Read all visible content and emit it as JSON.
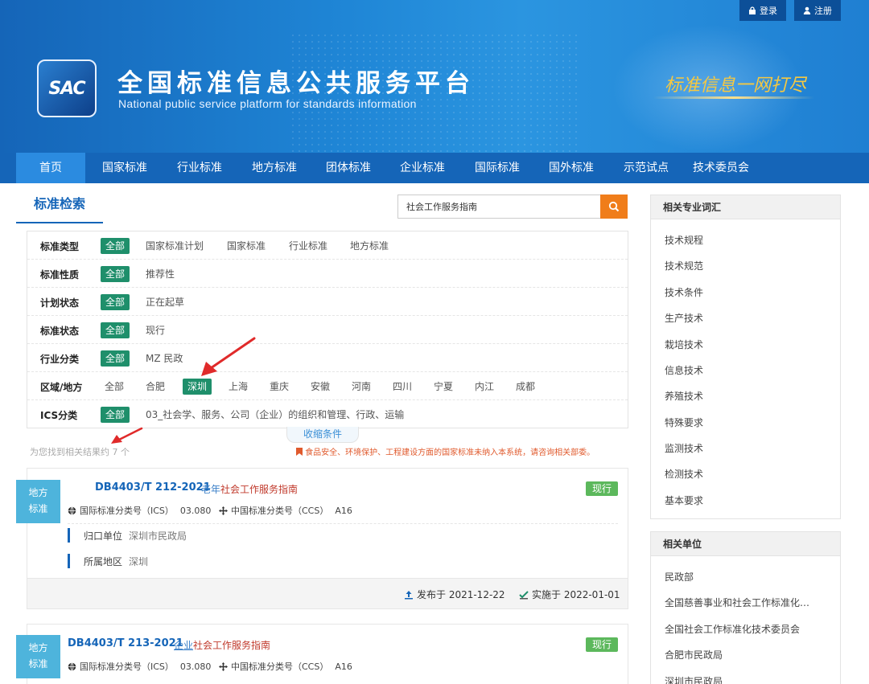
{
  "header": {
    "logo_text": "SAC",
    "title": "全国标准信息公共服务平台",
    "subtitle": "National public service platform  for standards information",
    "slogan": "标准信息一网打尽",
    "login_label": "登录",
    "register_label": "注册"
  },
  "nav": [
    "首页",
    "国家标准",
    "行业标准",
    "地方标准",
    "团体标准",
    "企业标准",
    "国际标准",
    "国外标准",
    "示范试点",
    "技术委员会"
  ],
  "search": {
    "tab_label": "标准检索",
    "query": "社会工作服务指南"
  },
  "filters": [
    {
      "label": "标准类型",
      "options": [
        "全部",
        "国家标准计划",
        "国家标准",
        "行业标准",
        "地方标准"
      ],
      "selected": 0
    },
    {
      "label": "标准性质",
      "options": [
        "全部",
        "推荐性"
      ],
      "selected": 0
    },
    {
      "label": "计划状态",
      "options": [
        "全部",
        "正在起草"
      ],
      "selected": 0
    },
    {
      "label": "标准状态",
      "options": [
        "全部",
        "现行"
      ],
      "selected": 0
    },
    {
      "label": "行业分类",
      "options": [
        "全部",
        "MZ 民政"
      ],
      "selected": 0
    },
    {
      "label": "区域/地方",
      "options": [
        "全部",
        "合肥",
        "深圳",
        "上海",
        "重庆",
        "安徽",
        "河南",
        "四川",
        "宁夏",
        "内江",
        "成都"
      ],
      "selected": 2
    },
    {
      "label": "ICS分类",
      "options": [
        "全部",
        "03_社会学、服务、公司（企业）的组织和管理、行政、运输"
      ],
      "selected": 0
    }
  ],
  "collapse_label": "收缩条件",
  "result_count_text": "为您找到相关结果约 7 个",
  "notice_text": "食品安全、环境保护、工程建设方面的国家标准未纳入本系统，请咨询相关部委。",
  "results": [
    {
      "tag_line1": "地方",
      "tag_line2": "标准",
      "number": "DB4403/T 212-2021",
      "title_prefix": "老年",
      "title_main": "社会工作服务指南",
      "status": "现行",
      "ics_label": "国际标准分类号（ICS）",
      "ics_value": "03.080",
      "ccs_label": "中国标准分类号（CCS）",
      "ccs_value": "A16",
      "dept_label": "归口单位",
      "dept_value": "深圳市民政局",
      "region_label": "所属地区",
      "region_value": "深圳",
      "publish": "发布于 2021-12-22",
      "implement": "实施于 2022-01-01"
    },
    {
      "tag_line1": "地方",
      "tag_line2": "标准",
      "number": "DB4403/T 213-2021",
      "title_prefix": "企业",
      "title_main": "社会工作服务指南",
      "status": "现行",
      "ics_label": "国际标准分类号（ICS）",
      "ics_value": "03.080",
      "ccs_label": "中国标准分类号（CCS）",
      "ccs_value": "A16"
    }
  ],
  "sidebar": {
    "terms_title": "相关专业词汇",
    "terms": [
      "技术规程",
      "技术规范",
      "技术条件",
      "生产技术",
      "栽培技术",
      "信息技术",
      "养殖技术",
      "特殊要求",
      "监测技术",
      "检测技术",
      "基本要求"
    ],
    "orgs_title": "相关单位",
    "orgs": [
      "民政部",
      "全国慈善事业和社会工作标准化…",
      "全国社会工作标准化技术委员会",
      "合肥市民政局",
      "深圳市民政局"
    ]
  },
  "colors": {
    "primary": "#1565b8",
    "nav_active": "#2b8be0",
    "selected_green": "#1f8f6b",
    "search_orange": "#f07d1a",
    "status_green": "#5cb85c",
    "tag_blue": "#4eb4dc",
    "annotation_red": "#e02a2a"
  }
}
